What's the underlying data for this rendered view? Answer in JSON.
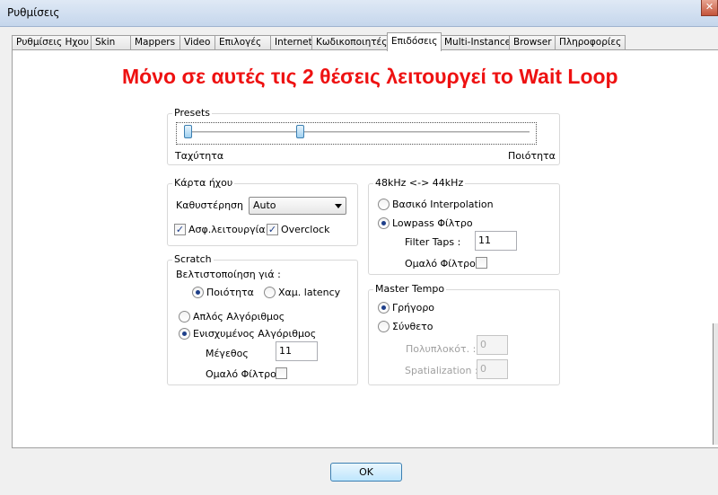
{
  "window": {
    "title": "Ρυθμίσεις",
    "close_symbol": "✕"
  },
  "tabs": [
    {
      "label": "Ρυθμίσεις Ηχου",
      "active": false
    },
    {
      "label": "Skin",
      "active": false
    },
    {
      "label": "Mappers",
      "active": false
    },
    {
      "label": "Video",
      "active": false
    },
    {
      "label": "Επιλογές",
      "active": false
    },
    {
      "label": "Internet",
      "active": false
    },
    {
      "label": "Κωδικοποιητές",
      "active": false
    },
    {
      "label": "Επιδόσεις",
      "active": true
    },
    {
      "label": "Multi-Instance",
      "active": false
    },
    {
      "label": "Browser",
      "active": false
    },
    {
      "label": "Πληροφορίες",
      "active": false
    }
  ],
  "notice": "Μόνο σε αυτές τις 2 θέσεις λειτουργεί το Wait Loop",
  "presets": {
    "title": "Presets",
    "left_label": "Ταχύτητα",
    "right_label": "Ποιότητα"
  },
  "soundcard": {
    "title": "Κάρτα ήχου",
    "latency_label": "Καθυστέρηση",
    "latency_value": "Auto",
    "safe_mode_label": "Ασφ.λειτουργία",
    "safe_mode_checked": true,
    "overclock_label": "Overclock",
    "overclock_checked": true
  },
  "resample": {
    "title": "48kHz <-> 44kHz",
    "basic_label": "Βασικό Interpolation",
    "lowpass_label": "Lowpass Φίλτρο",
    "filter_taps_label": "Filter Taps :",
    "filter_taps_value": "11",
    "smooth_filter_label": "Ομαλό Φίλτρο",
    "smooth_filter_checked": false
  },
  "scratch": {
    "title": "Scratch",
    "optimize_label": "Βελτιστοποίηση γιά :",
    "quality_label": "Ποιότητα",
    "low_latency_label": "Χαμ. latency",
    "simple_algo_label": "Απλός Αλγόριθμος",
    "enhanced_algo_label": "Ενισχυμένος Αλγόριθμος",
    "size_label": "Μέγεθος",
    "size_value": "11",
    "smooth_filter_label": "Ομαλό Φίλτρο",
    "smooth_filter_checked": false
  },
  "master_tempo": {
    "title": "Master Tempo",
    "fast_label": "Γρήγορο",
    "complex_label": "Σύνθετο",
    "complexity_label": "Πολυπλοκότ. :",
    "complexity_value": "0",
    "spatialization_label": "Spatialization :",
    "spatialization_value": "0"
  },
  "ok_label": "OK"
}
